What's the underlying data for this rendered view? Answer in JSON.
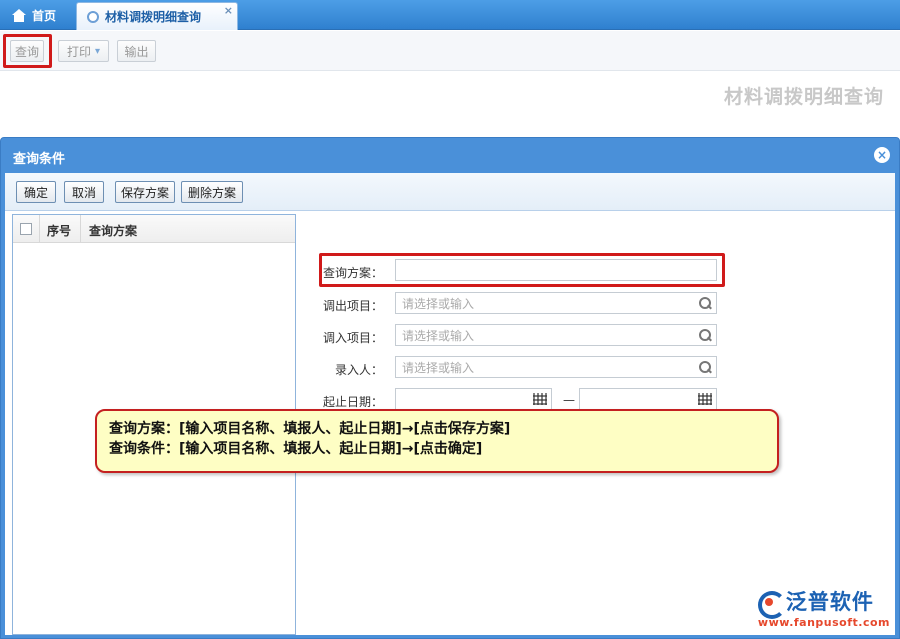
{
  "tabs": {
    "home_label": "首页",
    "active_label": "材料调拨明细查询",
    "close_glyph": "×"
  },
  "toolbar": {
    "query_label": "查询",
    "print_label": "打印",
    "print_arrow": "▾",
    "export_label": "输出"
  },
  "page_heading": "材料调拨明细查询",
  "dialog": {
    "title": "查询条件",
    "close_glyph": "×",
    "buttons": {
      "confirm": "确定",
      "cancel": "取消",
      "save_plan": "保存方案",
      "delete_plan": "删除方案"
    },
    "grid": {
      "columns": [
        "序号",
        "查询方案"
      ]
    },
    "form": {
      "plan_label": "查询方案：",
      "plan_value": "",
      "out_project_label": "调出项目：",
      "out_project_placeholder": "请选择或输入",
      "in_project_label": "调入项目：",
      "in_project_placeholder": "请选择或输入",
      "recorder_label": "录入人：",
      "recorder_placeholder": "请选择或输入",
      "date_label": "起止日期：",
      "date_start": "",
      "date_end": "",
      "date_separator": "—"
    }
  },
  "callout": {
    "line1": "查询方案：[输入项目名称、填报人、起止日期]→[点击保存方案]",
    "line2": "查询条件：[输入项目名称、填报人、起止日期]→[点击确定]"
  },
  "logo": {
    "name": "泛普软件",
    "url": "www.fanpusoft.com"
  },
  "colors": {
    "accent": "#4a90d9",
    "highlight": "#d01a1a",
    "callout_bg": "#fefec4",
    "brand": "#1c62b3"
  }
}
